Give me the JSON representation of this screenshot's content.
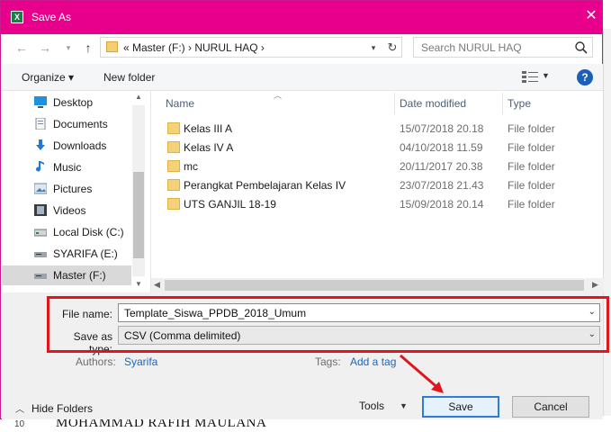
{
  "dialog": {
    "title": "Save As",
    "close_glyph": "✕",
    "app_icon_letter": "X",
    "title_color": "#e8008c"
  },
  "address_bar": {
    "path_text": "«  Master (F:)  ›  NURUL HAQ  ›",
    "search_placeholder": "Search NURUL HAQ"
  },
  "command_bar": {
    "organize_label": "Organize ▾",
    "new_folder_label": "New folder",
    "help_glyph": "?"
  },
  "nav_pane": {
    "items": [
      {
        "label": "Desktop",
        "icon": "desktop-icon"
      },
      {
        "label": "Documents",
        "icon": "documents-icon"
      },
      {
        "label": "Downloads",
        "icon": "downloads-icon"
      },
      {
        "label": "Music",
        "icon": "music-icon"
      },
      {
        "label": "Pictures",
        "icon": "pictures-icon"
      },
      {
        "label": "Videos",
        "icon": "videos-icon"
      },
      {
        "label": "Local Disk (C:)",
        "icon": "drive-icon"
      },
      {
        "label": "SYARIFA (E:)",
        "icon": "usb-drive-icon"
      },
      {
        "label": "Master (F:)",
        "icon": "usb-drive-icon",
        "selected": true
      }
    ]
  },
  "file_list": {
    "headers": {
      "name": "Name",
      "date": "Date modified",
      "type": "Type"
    },
    "rows": [
      {
        "name": "Kelas III A",
        "date": "15/07/2018 20.18",
        "type": "File folder"
      },
      {
        "name": "Kelas IV A",
        "date": "04/10/2018 11.59",
        "type": "File folder"
      },
      {
        "name": "mc",
        "date": "20/11/2017 20.38",
        "type": "File folder"
      },
      {
        "name": "Perangkat Pembelajaran Kelas IV",
        "date": "23/07/2018 21.43",
        "type": "File folder"
      },
      {
        "name": "UTS GANJIL 18-19",
        "date": "15/09/2018 20.14",
        "type": "File folder"
      }
    ]
  },
  "form": {
    "file_name_label": "File name:",
    "file_name_value": "Template_Siswa_PPDB_2018_Umum",
    "save_type_label": "Save as type:",
    "save_type_value": "CSV (Comma delimited)",
    "authors_label": "Authors:",
    "authors_value": "Syarifa",
    "tags_label": "Tags:",
    "tags_value": "Add a tag",
    "highlight_color": "#e0161e"
  },
  "footer": {
    "hide_folders_label": "Hide Folders",
    "tools_label": "Tools",
    "save_label": "Save",
    "cancel_label": "Cancel"
  },
  "background": {
    "row_number": "10",
    "cell_text": "MOHAMMAD RAFIH MAULANA"
  }
}
